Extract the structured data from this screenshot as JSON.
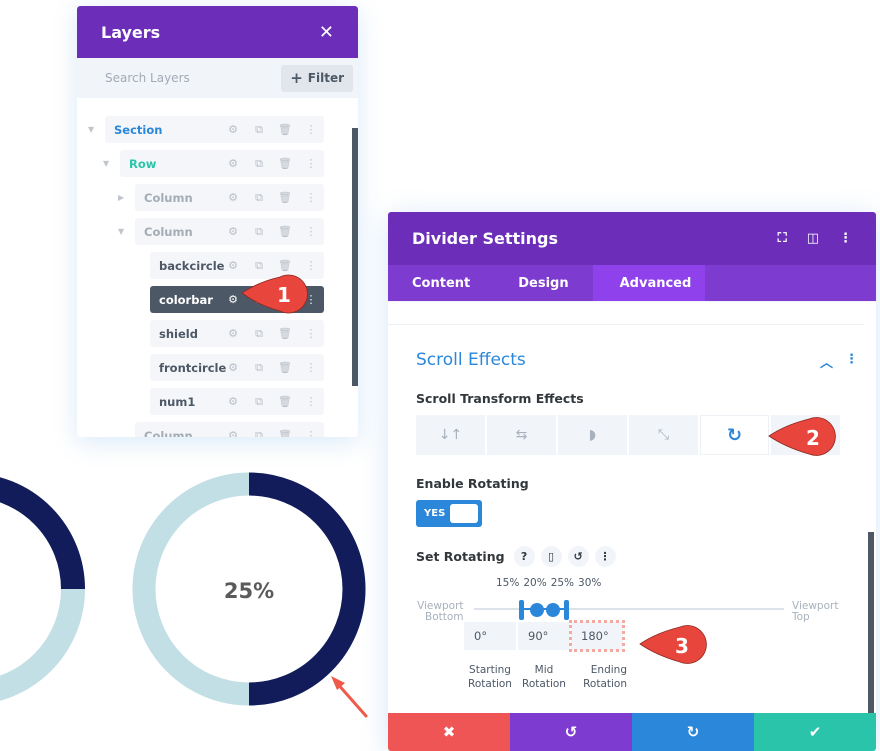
{
  "layers_panel": {
    "title": "Layers",
    "close_icon": "close-icon",
    "search_placeholder": "Search Layers",
    "filter_label": "Filter",
    "items": [
      {
        "label": "Section",
        "type": "section",
        "expanded": true
      },
      {
        "label": "Row",
        "type": "row",
        "expanded": true
      },
      {
        "label": "Column",
        "type": "column",
        "expanded": false
      },
      {
        "label": "Column",
        "type": "column",
        "expanded": true
      },
      {
        "label": "backcircle",
        "type": "module"
      },
      {
        "label": "colorbar",
        "type": "module",
        "active": true
      },
      {
        "label": "shield",
        "type": "module"
      },
      {
        "label": "frontcircle",
        "type": "module"
      },
      {
        "label": "num1",
        "type": "module"
      },
      {
        "label": "Column",
        "type": "column"
      }
    ],
    "row_icons": [
      "gear-icon",
      "duplicate-icon",
      "trash-icon",
      "more-icon"
    ]
  },
  "canvas": {
    "donut_label": "25%",
    "donut_progress": 0.5,
    "colors": {
      "track": "#c2dfe5",
      "fill": "#121c5a",
      "arrow": "#ef5a4a"
    }
  },
  "modal": {
    "title": "Divider Settings",
    "header_icons": [
      "focus-icon",
      "split-view-icon",
      "more-icon"
    ],
    "tabs": [
      {
        "label": "Content",
        "active": false
      },
      {
        "label": "Design",
        "active": false
      },
      {
        "label": "Advanced",
        "active": true
      }
    ],
    "section_title": "Scroll Effects",
    "scroll_transform_label": "Scroll Transform Effects",
    "effects": [
      {
        "name": "vertical-motion",
        "active": false
      },
      {
        "name": "horizontal-motion",
        "active": false
      },
      {
        "name": "fading",
        "active": false
      },
      {
        "name": "scaling",
        "active": false
      },
      {
        "name": "rotating",
        "active": true
      },
      {
        "name": "blur",
        "active": false
      }
    ],
    "enable_rotating_label": "Enable Rotating",
    "toggle_label": "YES",
    "toggle_on": true,
    "set_rotating_label": "Set Rotating",
    "percent_labels": [
      "15%",
      "20%",
      "25%",
      "30%"
    ],
    "viewport_bottom": [
      "Viewport",
      "Bottom"
    ],
    "viewport_top": [
      "Viewport",
      "Top"
    ],
    "rotations": [
      {
        "value": "0°",
        "caption": [
          "Starting",
          "Rotation"
        ]
      },
      {
        "value": "90°",
        "caption": [
          "Mid",
          "Rotation"
        ]
      },
      {
        "value": "180°",
        "caption": [
          "Ending",
          "Rotation"
        ],
        "highlighted": true
      }
    ],
    "footer": {
      "cancel": "✖",
      "undo": "↺",
      "redo": "↻",
      "save": "✔"
    }
  },
  "callouts": [
    "1",
    "2",
    "3"
  ],
  "colors": {
    "purple_header": "#6c2eb9",
    "tab_bar": "#7e3bd0",
    "tab_active": "#8f42ec",
    "blue": "#2b87da",
    "red": "#ef5555",
    "green": "#29c4a9",
    "callout": "#e8453c"
  }
}
